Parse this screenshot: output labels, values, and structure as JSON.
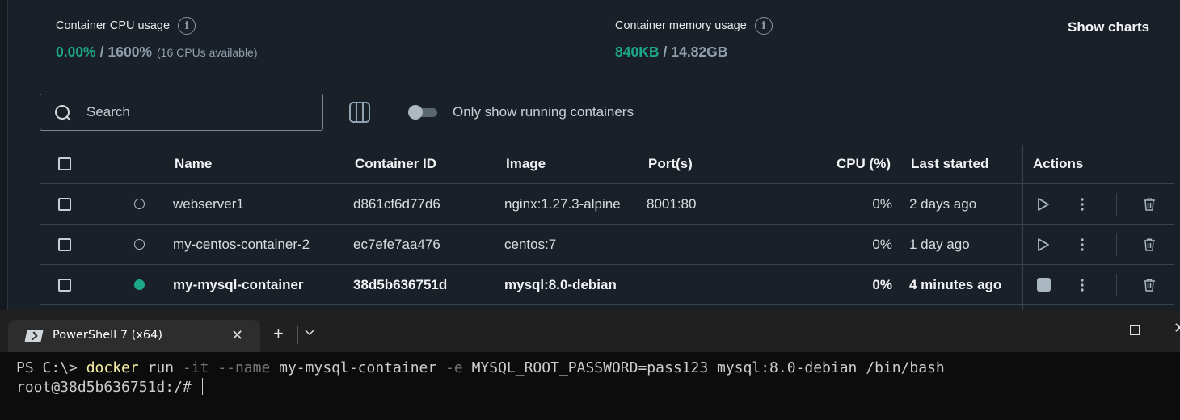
{
  "stats": {
    "cpu": {
      "label": "Container CPU usage",
      "used": "0.00%",
      "sep": "/",
      "total": "1600%",
      "note": "(16 CPUs available)"
    },
    "memory": {
      "label": "Container memory usage",
      "used": "840KB",
      "sep": "/",
      "total": "14.82GB"
    },
    "show_charts": "Show charts"
  },
  "toolbar": {
    "search_placeholder": "Search",
    "toggle_label": "Only show running containers",
    "toggle_on": false
  },
  "table": {
    "headers": {
      "name": "Name",
      "id": "Container ID",
      "image": "Image",
      "ports": "Port(s)",
      "cpu": "CPU (%)",
      "last_started": "Last started",
      "actions": "Actions"
    },
    "rows": [
      {
        "name": "webserver1",
        "id": "d861cf6d77d6",
        "image": "nginx:1.27.3-alpine",
        "ports": "8001:80",
        "cpu": "0%",
        "last_started": "2 days ago",
        "running": false
      },
      {
        "name": "my-centos-container-2",
        "id": "ec7efe7aa476",
        "image": "centos:7",
        "ports": "",
        "cpu": "0%",
        "last_started": "1 day ago",
        "running": false
      },
      {
        "name": "my-mysql-container",
        "id": "38d5b636751d",
        "image": "mysql:8.0-debian",
        "ports": "",
        "cpu": "0%",
        "last_started": "4 minutes ago",
        "running": true
      }
    ]
  },
  "terminal": {
    "tab_title": "PowerShell 7 (x64)",
    "new_tab": "+",
    "prompt": "PS C:\\> ",
    "command": "docker",
    "arg_run": " run ",
    "flag_it": "-it",
    "flag_name": " --name",
    "name_value": " my-mysql-container ",
    "flag_e": "-e",
    "rest": " MYSQL_ROOT_PASSWORD=pass123 mysql:8.0-debian /bin/bash",
    "line2": "root@38d5b636751d:/# "
  },
  "colors": {
    "accent_green": "#1ca889",
    "background": "#1a2027",
    "terminal_bg": "#0c0c0c"
  }
}
